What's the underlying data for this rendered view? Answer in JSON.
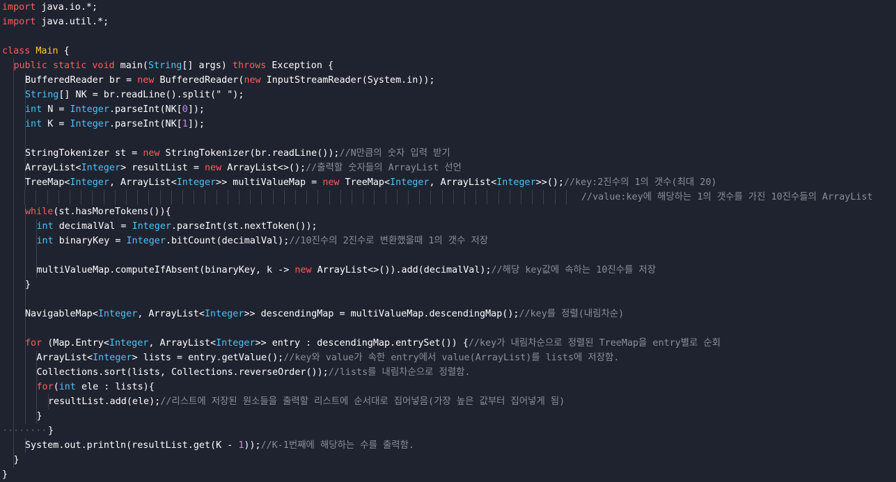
{
  "colors": {
    "background": "#1f2330",
    "keyword": "#ff5b5b",
    "type": "#4fc3f7",
    "class_name": "#ffcc33",
    "number": "#c58af9",
    "comment": "#8a8f98",
    "plain": "#ffffff"
  },
  "code": {
    "lines": [
      {
        "indent": 0,
        "tokens": [
          {
            "c": "kw",
            "t": "import"
          },
          {
            "c": "pl",
            "t": " java.io.*;"
          }
        ]
      },
      {
        "indent": 0,
        "tokens": [
          {
            "c": "kw",
            "t": "import"
          },
          {
            "c": "pl",
            "t": " java.util.*;"
          }
        ]
      },
      {
        "indent": 0,
        "tokens": []
      },
      {
        "indent": 0,
        "tokens": [
          {
            "c": "kw",
            "t": "class"
          },
          {
            "c": "pl",
            "t": " "
          },
          {
            "c": "cls",
            "t": "Main"
          },
          {
            "c": "pl",
            "t": " {"
          }
        ]
      },
      {
        "indent": 1,
        "tokens": [
          {
            "c": "kw",
            "t": "public"
          },
          {
            "c": "pl",
            "t": " "
          },
          {
            "c": "kw",
            "t": "static"
          },
          {
            "c": "pl",
            "t": " "
          },
          {
            "c": "kw",
            "t": "void"
          },
          {
            "c": "pl",
            "t": " main("
          },
          {
            "c": "ty",
            "t": "String"
          },
          {
            "c": "pl",
            "t": "[] args) "
          },
          {
            "c": "kw",
            "t": "throws"
          },
          {
            "c": "pl",
            "t": " Exception {"
          }
        ]
      },
      {
        "indent": 2,
        "tokens": [
          {
            "c": "pl",
            "t": "BufferedReader br = "
          },
          {
            "c": "kw",
            "t": "new"
          },
          {
            "c": "pl",
            "t": " BufferedReader("
          },
          {
            "c": "kw",
            "t": "new"
          },
          {
            "c": "pl",
            "t": " InputStreamReader(System.in));"
          }
        ]
      },
      {
        "indent": 2,
        "tokens": [
          {
            "c": "ty",
            "t": "String"
          },
          {
            "c": "pl",
            "t": "[] NK = br.readLine().split(\" \");"
          }
        ]
      },
      {
        "indent": 2,
        "tokens": [
          {
            "c": "ty",
            "t": "int"
          },
          {
            "c": "pl",
            "t": " N = "
          },
          {
            "c": "ty",
            "t": "Integer"
          },
          {
            "c": "pl",
            "t": ".parseInt(NK["
          },
          {
            "c": "num",
            "t": "0"
          },
          {
            "c": "pl",
            "t": "]);"
          }
        ]
      },
      {
        "indent": 2,
        "tokens": [
          {
            "c": "ty",
            "t": "int"
          },
          {
            "c": "pl",
            "t": " K = "
          },
          {
            "c": "ty",
            "t": "Integer"
          },
          {
            "c": "pl",
            "t": ".parseInt(NK["
          },
          {
            "c": "num",
            "t": "1"
          },
          {
            "c": "pl",
            "t": "]);"
          }
        ]
      },
      {
        "indent": 2,
        "tokens": []
      },
      {
        "indent": 2,
        "tokens": [
          {
            "c": "pl",
            "t": "StringTokenizer st = "
          },
          {
            "c": "kw",
            "t": "new"
          },
          {
            "c": "pl",
            "t": " StringTokenizer(br.readLine());"
          },
          {
            "c": "cm",
            "t": "//N만큼의 숫자 입력 받기"
          }
        ]
      },
      {
        "indent": 2,
        "tokens": [
          {
            "c": "pl",
            "t": "ArrayList<"
          },
          {
            "c": "ty",
            "t": "Integer"
          },
          {
            "c": "pl",
            "t": "> resultList = "
          },
          {
            "c": "kw",
            "t": "new"
          },
          {
            "c": "pl",
            "t": " ArrayList<>();"
          },
          {
            "c": "cm",
            "t": "//출력할 숫자들의 ArrayList 선언"
          }
        ]
      },
      {
        "indent": 2,
        "tokens": [
          {
            "c": "pl",
            "t": "TreeMap<"
          },
          {
            "c": "ty",
            "t": "Integer"
          },
          {
            "c": "pl",
            "t": ", ArrayList<"
          },
          {
            "c": "ty",
            "t": "Integer"
          },
          {
            "c": "pl",
            "t": ">> multiValueMap = "
          },
          {
            "c": "kw",
            "t": "new"
          },
          {
            "c": "pl",
            "t": " TreeMap<"
          },
          {
            "c": "ty",
            "t": "Integer"
          },
          {
            "c": "pl",
            "t": ", ArrayList<"
          },
          {
            "c": "ty",
            "t": "Integer"
          },
          {
            "c": "pl",
            "t": ">>();"
          },
          {
            "c": "cm",
            "t": "//key:2진수의 1의 갯수(최대 20)"
          }
        ]
      },
      {
        "indent": 2,
        "continuation": true,
        "tokens": [
          {
            "c": "cm",
            "t": "//value:key에 해당하는 1의 갯수를 가진 10진수들의 ArrayList"
          }
        ]
      },
      {
        "indent": 2,
        "tokens": [
          {
            "c": "kw",
            "t": "while"
          },
          {
            "c": "pl",
            "t": "(st.hasMoreTokens()){"
          }
        ]
      },
      {
        "indent": 3,
        "tokens": [
          {
            "c": "ty",
            "t": "int"
          },
          {
            "c": "pl",
            "t": " decimalVal = "
          },
          {
            "c": "ty",
            "t": "Integer"
          },
          {
            "c": "pl",
            "t": ".parseInt(st.nextToken());"
          }
        ]
      },
      {
        "indent": 3,
        "tokens": [
          {
            "c": "ty",
            "t": "int"
          },
          {
            "c": "pl",
            "t": " binaryKey = "
          },
          {
            "c": "ty",
            "t": "Integer"
          },
          {
            "c": "pl",
            "t": ".bitCount(decimalVal);"
          },
          {
            "c": "cm",
            "t": "//10진수의 2진수로 변환했을때 1의 갯수 저장"
          }
        ]
      },
      {
        "indent": 3,
        "tokens": []
      },
      {
        "indent": 3,
        "tokens": [
          {
            "c": "pl",
            "t": "multiValueMap.computeIfAbsent(binaryKey, k -> "
          },
          {
            "c": "kw",
            "t": "new"
          },
          {
            "c": "pl",
            "t": " ArrayList<>()).add(decimalVal);"
          },
          {
            "c": "cm",
            "t": "//해당 key값에 속하는 10진수를 저장"
          }
        ]
      },
      {
        "indent": 2,
        "tokens": [
          {
            "c": "pl",
            "t": "}"
          }
        ]
      },
      {
        "indent": 2,
        "tokens": []
      },
      {
        "indent": 2,
        "tokens": [
          {
            "c": "pl",
            "t": "NavigableMap<"
          },
          {
            "c": "ty",
            "t": "Integer"
          },
          {
            "c": "pl",
            "t": ", ArrayList<"
          },
          {
            "c": "ty",
            "t": "Integer"
          },
          {
            "c": "pl",
            "t": ">> descendingMap = multiValueMap.descendingMap();"
          },
          {
            "c": "cm",
            "t": "//key를 정렬(내림차순)"
          }
        ]
      },
      {
        "indent": 2,
        "tokens": []
      },
      {
        "indent": 2,
        "tokens": [
          {
            "c": "kw",
            "t": "for"
          },
          {
            "c": "pl",
            "t": " (Map.Entry<"
          },
          {
            "c": "ty",
            "t": "Integer"
          },
          {
            "c": "pl",
            "t": ", ArrayList<"
          },
          {
            "c": "ty",
            "t": "Integer"
          },
          {
            "c": "pl",
            "t": ">> entry : descendingMap.entrySet()) {"
          },
          {
            "c": "cm",
            "t": "//key가 내림차순으로 정렬된 TreeMap을 entry별로 순회"
          }
        ]
      },
      {
        "indent": 3,
        "tokens": [
          {
            "c": "pl",
            "t": "ArrayList<"
          },
          {
            "c": "ty",
            "t": "Integer"
          },
          {
            "c": "pl",
            "t": "> lists = entry.getValue();"
          },
          {
            "c": "cm",
            "t": "//key와 value가 속한 entry에서 value(ArrayList)를 lists에 저장함."
          }
        ]
      },
      {
        "indent": 3,
        "tokens": [
          {
            "c": "pl",
            "t": "Collections.sort(lists, Collections.reverseOrder());"
          },
          {
            "c": "cm",
            "t": "//lists를 내림차순으로 정렬함."
          }
        ]
      },
      {
        "indent": 3,
        "tokens": [
          {
            "c": "kw",
            "t": "for"
          },
          {
            "c": "pl",
            "t": "("
          },
          {
            "c": "ty",
            "t": "int"
          },
          {
            "c": "pl",
            "t": " ele : lists){"
          }
        ]
      },
      {
        "indent": 4,
        "tokens": [
          {
            "c": "pl",
            "t": "resultList.add(ele);"
          },
          {
            "c": "cm",
            "t": "//리스트에 저장된 원소들을 출력할 리스트에 순서대로 집어넣음(가장 높은 값부터 집어넣게 됨)"
          }
        ]
      },
      {
        "indent": 3,
        "tokens": [
          {
            "c": "pl",
            "t": "}"
          }
        ]
      },
      {
        "indent": 4,
        "dots": true,
        "tokens": [
          {
            "c": "pl",
            "t": "}"
          }
        ]
      },
      {
        "indent": 2,
        "tokens": [
          {
            "c": "pl",
            "t": "System.out.println(resultList.get(K - "
          },
          {
            "c": "num",
            "t": "1"
          },
          {
            "c": "pl",
            "t": "));"
          },
          {
            "c": "cm",
            "t": "//K-1번째에 해당하는 수를 출력함."
          }
        ]
      },
      {
        "indent": 1,
        "tokens": [
          {
            "c": "pl",
            "t": "}"
          }
        ]
      },
      {
        "indent": 0,
        "tokens": [
          {
            "c": "pl",
            "t": "}"
          }
        ]
      }
    ]
  }
}
